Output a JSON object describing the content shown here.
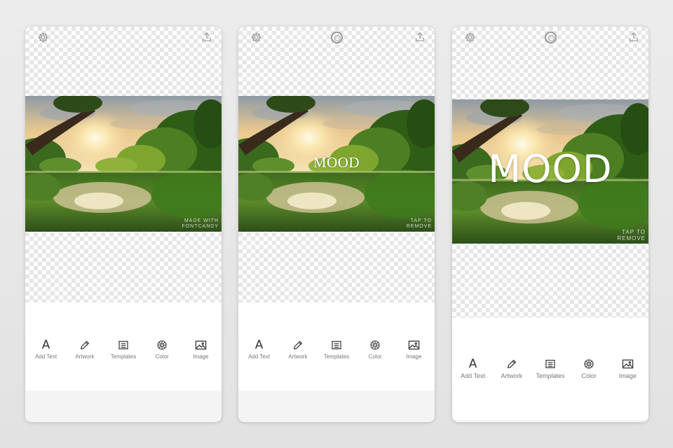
{
  "screens": [
    {
      "id": "empty",
      "overlay_text": "",
      "watermark": [
        "MADE WITH",
        "FONTCANDY"
      ]
    },
    {
      "id": "small-text",
      "overlay_text": "MOOD",
      "watermark": [
        "TAP TO",
        "REMOVE"
      ]
    },
    {
      "id": "large-text",
      "overlay_text": "MOOD",
      "watermark": [
        "TAP TO",
        "REMOVE"
      ]
    }
  ],
  "toolbar": {
    "add_text": "Add Text",
    "artwork": "Artwork",
    "templates": "Templates",
    "color": "Color",
    "image": "Image"
  },
  "icons": {
    "settings": "gear-icon",
    "record": "record-icon",
    "share": "share-icon",
    "add_text": "letter-a-icon",
    "artwork": "pencil-icon",
    "templates": "list-icon",
    "color": "color-wheel-icon",
    "image": "image-icon"
  },
  "colors": {
    "icon_gray": "#9a9a9a",
    "label_gray": "#777777",
    "toolbar_bg": "#ffffff"
  }
}
